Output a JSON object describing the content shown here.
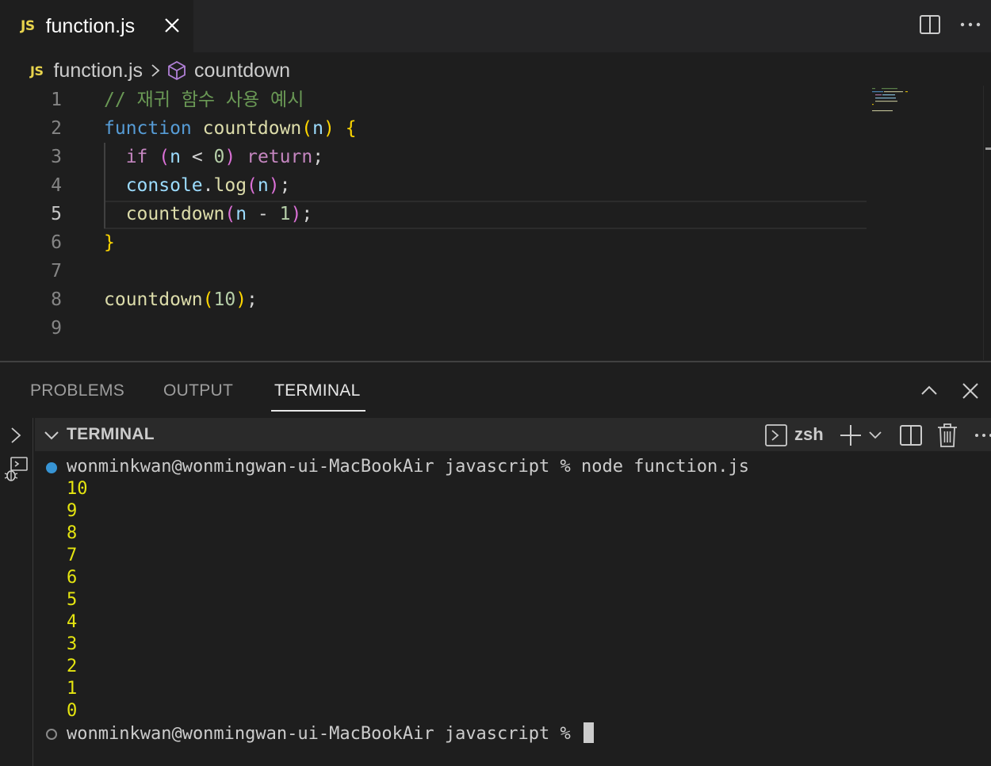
{
  "tab": {
    "badge": "JS",
    "title": "function.js"
  },
  "breadcrumb": {
    "badge": "JS",
    "file": "function.js",
    "symbol": "countdown"
  },
  "editor": {
    "active_line": 5,
    "lines": [
      {
        "n": "1",
        "tokens": [
          {
            "t": "// 재귀 함수 사용 예시",
            "c": "com"
          }
        ]
      },
      {
        "n": "2",
        "tokens": [
          {
            "t": "function",
            "c": "kw"
          },
          {
            "t": " ",
            "c": "pun"
          },
          {
            "t": "countdown",
            "c": "fn"
          },
          {
            "t": "(",
            "c": "b1"
          },
          {
            "t": "n",
            "c": "var"
          },
          {
            "t": ")",
            "c": "b1"
          },
          {
            "t": " ",
            "c": "pun"
          },
          {
            "t": "{",
            "c": "b1"
          }
        ]
      },
      {
        "n": "3",
        "tokens": [
          {
            "t": "  ",
            "c": "pun"
          },
          {
            "t": "if",
            "c": "ctl"
          },
          {
            "t": " ",
            "c": "pun"
          },
          {
            "t": "(",
            "c": "b2"
          },
          {
            "t": "n",
            "c": "var"
          },
          {
            "t": " < ",
            "c": "pun"
          },
          {
            "t": "0",
            "c": "num"
          },
          {
            "t": ")",
            "c": "b2"
          },
          {
            "t": " ",
            "c": "pun"
          },
          {
            "t": "return",
            "c": "ctl"
          },
          {
            "t": ";",
            "c": "pun"
          }
        ]
      },
      {
        "n": "4",
        "tokens": [
          {
            "t": "  ",
            "c": "pun"
          },
          {
            "t": "console",
            "c": "var"
          },
          {
            "t": ".",
            "c": "pun"
          },
          {
            "t": "log",
            "c": "fn"
          },
          {
            "t": "(",
            "c": "b2"
          },
          {
            "t": "n",
            "c": "var"
          },
          {
            "t": ")",
            "c": "b2"
          },
          {
            "t": ";",
            "c": "pun"
          }
        ]
      },
      {
        "n": "5",
        "tokens": [
          {
            "t": "  ",
            "c": "pun"
          },
          {
            "t": "countdown",
            "c": "fn"
          },
          {
            "t": "(",
            "c": "b2"
          },
          {
            "t": "n",
            "c": "var"
          },
          {
            "t": " - ",
            "c": "pun"
          },
          {
            "t": "1",
            "c": "num"
          },
          {
            "t": ")",
            "c": "b2"
          },
          {
            "t": ";",
            "c": "pun"
          }
        ]
      },
      {
        "n": "6",
        "tokens": [
          {
            "t": "}",
            "c": "b1"
          }
        ]
      },
      {
        "n": "7",
        "tokens": []
      },
      {
        "n": "8",
        "tokens": [
          {
            "t": "countdown",
            "c": "fn"
          },
          {
            "t": "(",
            "c": "b1"
          },
          {
            "t": "10",
            "c": "num"
          },
          {
            "t": ")",
            "c": "b1"
          },
          {
            "t": ";",
            "c": "pun"
          }
        ]
      },
      {
        "n": "9",
        "tokens": []
      }
    ]
  },
  "panel": {
    "tabs": [
      "PROBLEMS",
      "OUTPUT",
      "TERMINAL"
    ],
    "active_tab": "TERMINAL"
  },
  "terminal": {
    "header_title": "TERMINAL",
    "shell": "zsh",
    "prompt": "wonminkwan@wonmingwan-ui-MacBookAir javascript % ",
    "command": "node function.js",
    "output": [
      "10",
      "9",
      "8",
      "7",
      "6",
      "5",
      "4",
      "3",
      "2",
      "1",
      "0"
    ]
  },
  "colors": {
    "js_badge": "#e8d44d",
    "terminal_output": "#e5e510",
    "status_dot": "#3794d4"
  },
  "icons": [
    "close-icon",
    "split-editor-icon",
    "more-actions-icon",
    "chevron-right-icon",
    "symbol-method-icon",
    "chevron-up-icon",
    "terminal-shell-icon",
    "plus-icon",
    "chevron-down-icon",
    "split-terminal-icon",
    "trash-icon",
    "debug-icon"
  ]
}
